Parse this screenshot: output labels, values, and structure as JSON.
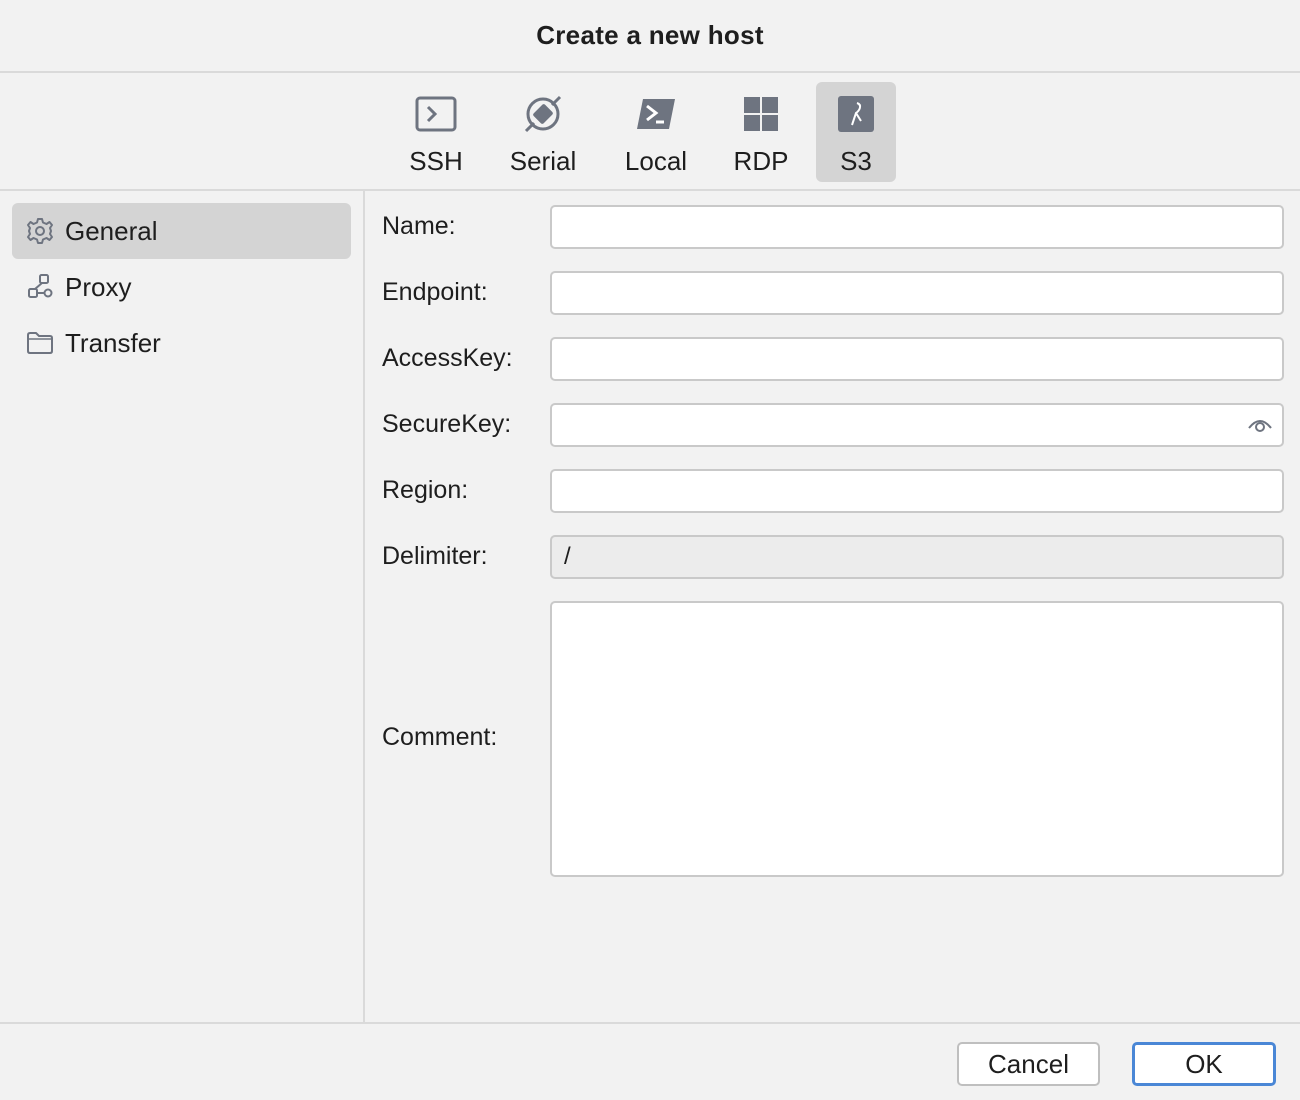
{
  "dialog": {
    "title": "Create a new host"
  },
  "protocols": [
    {
      "label": "SSH",
      "icon": "terminal-icon",
      "active": false
    },
    {
      "label": "Serial",
      "icon": "plug-icon",
      "active": false
    },
    {
      "label": "Local",
      "icon": "powershell-icon",
      "active": false
    },
    {
      "label": "RDP",
      "icon": "windows-icon",
      "active": false
    },
    {
      "label": "S3",
      "icon": "s3-bucket-icon",
      "active": true
    }
  ],
  "sidebar": {
    "items": [
      {
        "label": "General",
        "icon": "gear-icon",
        "active": true
      },
      {
        "label": "Proxy",
        "icon": "network-icon",
        "active": false
      },
      {
        "label": "Transfer",
        "icon": "folder-icon",
        "active": false
      }
    ]
  },
  "form": {
    "name": {
      "label": "Name:",
      "value": ""
    },
    "endpoint": {
      "label": "Endpoint:",
      "value": ""
    },
    "access_key": {
      "label": "AccessKey:",
      "value": ""
    },
    "secure_key": {
      "label": "SecureKey:",
      "value": "",
      "icon": "eye-icon"
    },
    "region": {
      "label": "Region:",
      "value": ""
    },
    "delimiter": {
      "label": "Delimiter:",
      "value": "/",
      "disabled": true
    },
    "comment": {
      "label": "Comment:",
      "value": ""
    }
  },
  "footer": {
    "cancel_label": "Cancel",
    "ok_label": "OK"
  },
  "colors": {
    "background": "#f2f2f2",
    "selected": "#d4d4d4",
    "accent": "#4a87d6",
    "icon": "#6e7480"
  }
}
